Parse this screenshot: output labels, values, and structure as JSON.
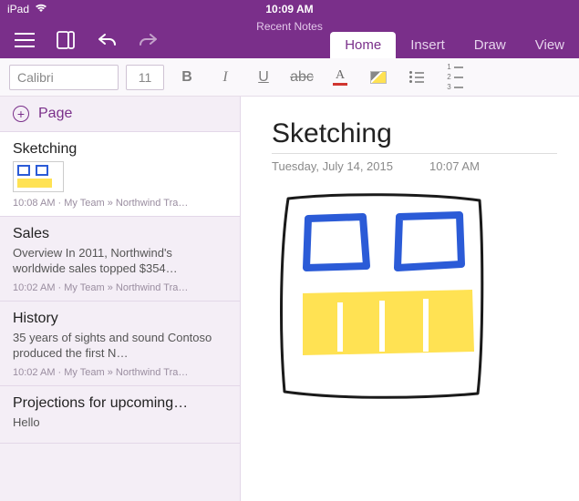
{
  "statusbar": {
    "device": "iPad",
    "time": "10:09 AM"
  },
  "header": {
    "section": "Recent Notes",
    "tabs": [
      {
        "label": "Home",
        "active": true
      },
      {
        "label": "Insert",
        "active": false
      },
      {
        "label": "Draw",
        "active": false
      },
      {
        "label": "View",
        "active": false
      }
    ]
  },
  "toolbar": {
    "font_name": "Calibri",
    "font_size": "11"
  },
  "sidebar": {
    "add_page_label": "Page",
    "pages": [
      {
        "title": "Sketching",
        "preview": "",
        "has_thumb": true,
        "meta": "10:08 AM · My Team » Northwind Tra…"
      },
      {
        "title": "Sales",
        "preview": "Overview  In 2011, Northwind's worldwide sales topped $354…",
        "meta": "10:02 AM · My Team » Northwind Tra…"
      },
      {
        "title": "History",
        "preview": "35 years of sights and sound Contoso produced the first N…",
        "meta": "10:02 AM · My Team » Northwind Tra…"
      },
      {
        "title": "Projections for upcoming…",
        "preview": "Hello",
        "meta": ""
      }
    ]
  },
  "note": {
    "title": "Sketching",
    "date": "Tuesday, July 14, 2015",
    "time": "10:07 AM"
  }
}
